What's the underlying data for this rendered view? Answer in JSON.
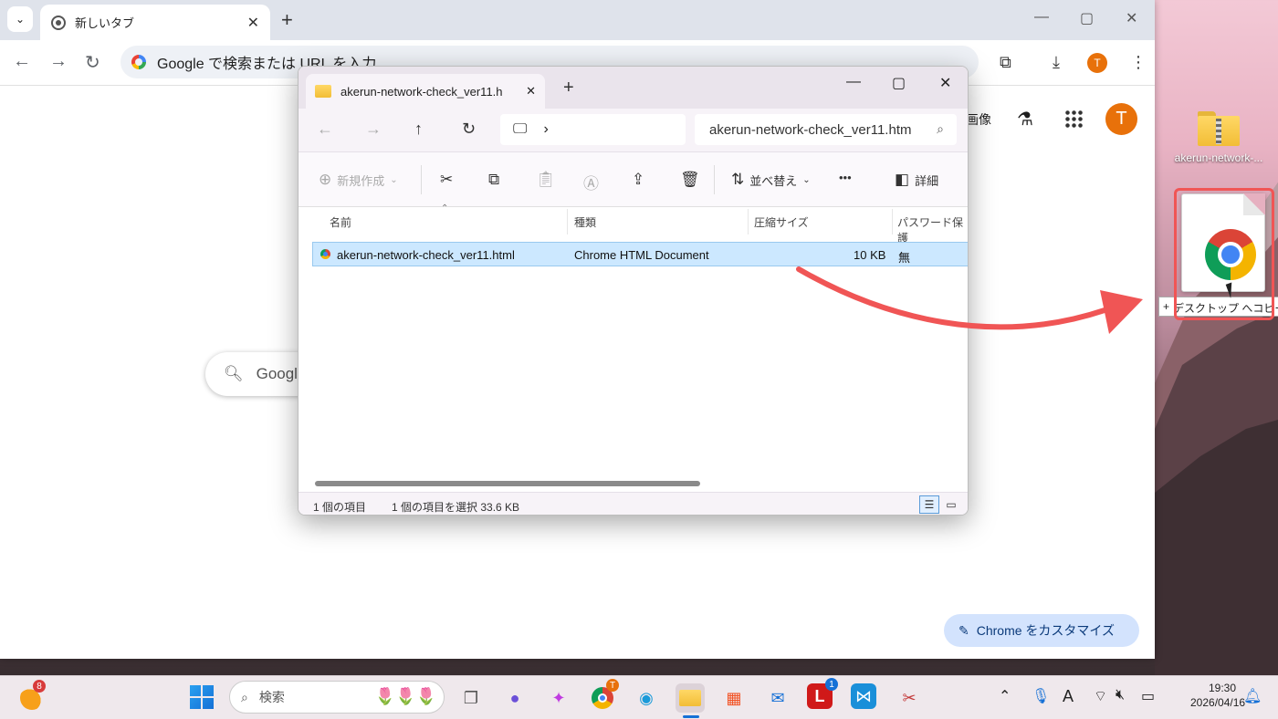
{
  "chrome": {
    "tab_title": "新しいタブ",
    "omnibox_placeholder": "Google で検索または URL を入力",
    "avatar_letter": "T",
    "ntp_images_link": "画像",
    "search_pill_text": "Googl",
    "customize_label": "Chrome をカスタマイズ"
  },
  "explorer": {
    "tab_title": "akerun-network-check_ver11.h",
    "search_value": "akerun-network-check_ver11.htm",
    "commands": {
      "new": "新規作成",
      "sort": "並べ替え",
      "more": "•••",
      "details": "詳細"
    },
    "columns": [
      "名前",
      "種類",
      "圧縮サイズ",
      "パスワード保護"
    ],
    "rows": [
      {
        "name": "akerun-network-check_ver11.html",
        "type": "Chrome HTML Document",
        "size": "10 KB",
        "password": "無",
        "selected": true
      }
    ],
    "status": {
      "count": "1 個の項目",
      "selected": "1 個の項目を選択  33.6 KB"
    }
  },
  "desktop": {
    "zip_folder_label": "akerun-network-...",
    "drag_tooltip_plus": "+",
    "drag_tooltip": "デスクトップ へコピー",
    "arrow_color": "#f05555"
  },
  "taskbar": {
    "weather_badge": "8",
    "search_placeholder": "検索",
    "chrome_badge": "T",
    "app_badge": "1",
    "time": "19:30",
    "date": "2026/04/16",
    "ime": "A"
  }
}
